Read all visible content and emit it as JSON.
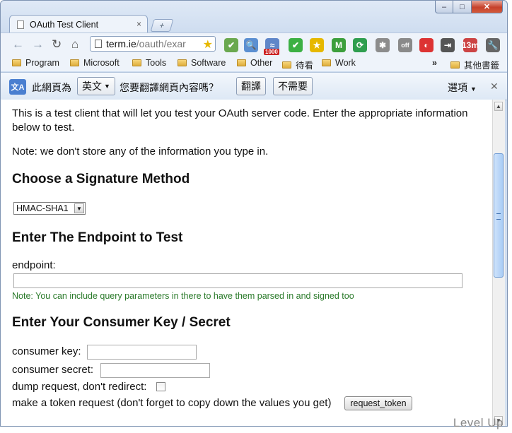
{
  "window": {
    "min_glyph": "–",
    "max_glyph": "□",
    "close_glyph": "✕"
  },
  "tab": {
    "title": "OAuth Test Client",
    "close_glyph": "×",
    "new_tab_glyph": "+"
  },
  "nav": {
    "back": "←",
    "forward": "→",
    "reload": "↻",
    "home": "⌂"
  },
  "omnibox": {
    "host": "term.ie",
    "path": "/oauth/exar"
  },
  "extensions": [
    {
      "name": "check-icon",
      "label": "✔",
      "color": "#6aa84f"
    },
    {
      "name": "search-icon",
      "label": "🔍",
      "color": "#5b8fd1"
    },
    {
      "name": "rss-icon",
      "label": "≈",
      "color": "#5f86c9",
      "badge": "1000"
    },
    {
      "name": "ok-icon",
      "label": "✔",
      "color": "#3cb043"
    },
    {
      "name": "star-icon",
      "label": "★",
      "color": "#e6b800"
    },
    {
      "name": "m-icon",
      "label": "M",
      "color": "#3c9f3c"
    },
    {
      "name": "sync-icon",
      "label": "⟳",
      "color": "#2f9e4f"
    },
    {
      "name": "bug-icon",
      "label": "✱",
      "color": "#8c8c8c"
    },
    {
      "name": "off-icon",
      "label": "off",
      "color": "#8a8a8a"
    },
    {
      "name": "swirl-icon",
      "label": "◐",
      "color": "#d33"
    },
    {
      "name": "export-icon",
      "label": "⇥",
      "color": "#555"
    },
    {
      "name": "calendar-icon",
      "label": "13m",
      "color": "#c44"
    },
    {
      "name": "wrench-icon",
      "label": "🔧",
      "color": "#666"
    }
  ],
  "bookmarks": {
    "items": [
      "Program",
      "Microsoft",
      "Tools",
      "Software",
      "Other",
      "待看",
      "Work"
    ],
    "overflow": "»",
    "other": "其他書籤"
  },
  "translate": {
    "label": "此網頁為",
    "language": "英文",
    "question": "您要翻譯網頁內容嗎？",
    "translate_button": "翻譯",
    "decline_button": "不需要",
    "options": "選項",
    "close": "✕"
  },
  "page": {
    "intro": "This is a test client that will let you test your OAuth server code. Enter the appropriate information below to test.",
    "note": "Note: we don't store any of the information you type in.",
    "sig_heading": "Choose a Signature Method",
    "sig_method": "HMAC-SHA1",
    "endpoint_heading": "Enter The Endpoint to Test",
    "endpoint_label": "endpoint:",
    "endpoint_note": "Note: You can include query parameters in there to have them parsed in and signed too",
    "consumer_heading": "Enter Your Consumer Key / Secret",
    "consumer_key_label": "consumer key:",
    "consumer_secret_label": "consumer secret:",
    "dump_label": "dump request, don't redirect:",
    "token_label": "make a token request (don't forget to copy down the values you get)",
    "request_token_button": "request_token"
  },
  "watermark": "Level Up"
}
